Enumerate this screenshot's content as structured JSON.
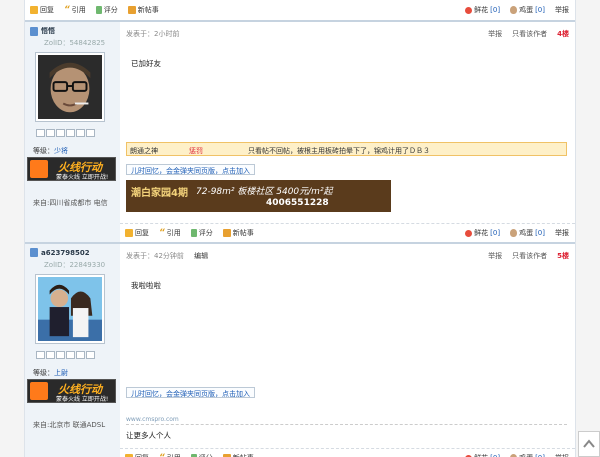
{
  "toolbar": {
    "reply": "回复",
    "quote": "引用",
    "rate": "评分",
    "new_post": "新帖事",
    "flower": "鲜花",
    "egg": "鸡蛋",
    "count_flower": "[0]",
    "count_egg": "[0]",
    "report": "举报"
  },
  "posts": [
    {
      "username": "悟悟",
      "zid": "ZolID：54842825",
      "level_label": "等级：",
      "level_value": "少将",
      "banner_main": "火线行动",
      "banner_sub": "蒙泰火线 立即开战!",
      "from": "来自:四川省成都市 电信",
      "posted": "发表于：2小时前",
      "report": "举报",
      "only_author": "只看该作者",
      "floor": "4楼",
      "body": "已加好友",
      "notice": [
        "朗通之神",
        "惩罚",
        "只看帖不回帖，被根主用板砖拍晕下了，锦鸡计用了ＤＢ３"
      ],
      "link": "儿时回忆，会金弹夹同页版，点击加入",
      "ad": {
        "name": "潮白家园4期",
        "price": "72-98m² 板楼社区 5400元/m²起",
        "phone": "4006551228"
      }
    },
    {
      "username": "a623798502",
      "zid": "ZolID：22849330",
      "level_label": "等级：",
      "level_value": "上尉",
      "banner_main": "火线行动",
      "banner_sub": "蒙泰火线 立即开战!",
      "from": "来自:北京市 联通ADSL",
      "posted": "发表于：42分钟前",
      "edit": "编辑",
      "report": "举报",
      "only_author": "只看该作者",
      "floor": "5楼",
      "body": "我啦啦啦",
      "link": "儿时回忆，会金弹夹同页版，点击加入",
      "small_link": "www.cmspro.com",
      "signature": "让更多人个人"
    }
  ]
}
